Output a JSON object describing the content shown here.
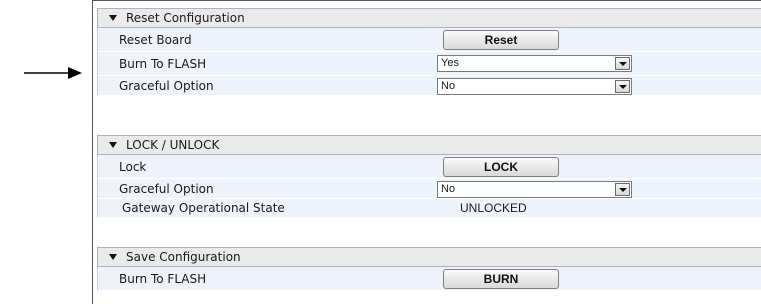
{
  "reset_section": {
    "title": "Reset Configuration",
    "reset_board_label": "Reset Board",
    "reset_button": "Reset",
    "burn_to_flash_label": "Burn To FLASH",
    "burn_to_flash_value": "Yes",
    "graceful_option_label": "Graceful Option",
    "graceful_option_value": "No"
  },
  "lock_section": {
    "title": "LOCK / UNLOCK",
    "lock_label": "Lock",
    "lock_button": "LOCK",
    "graceful_option_label": "Graceful Option",
    "graceful_option_value": "No",
    "state_label": "Gateway Operational State",
    "state_value": "UNLOCKED"
  },
  "save_section": {
    "title": "Save Configuration",
    "burn_to_flash_label": "Burn To FLASH",
    "burn_button": "BURN"
  },
  "icons": {
    "section_toggle": "triangle-down-icon",
    "dropdown": "chevron-down-icon",
    "pointer": "arrow-right-icon"
  },
  "colors": {
    "row_background": "#eef2fa",
    "header_background": "#eaeaea"
  }
}
